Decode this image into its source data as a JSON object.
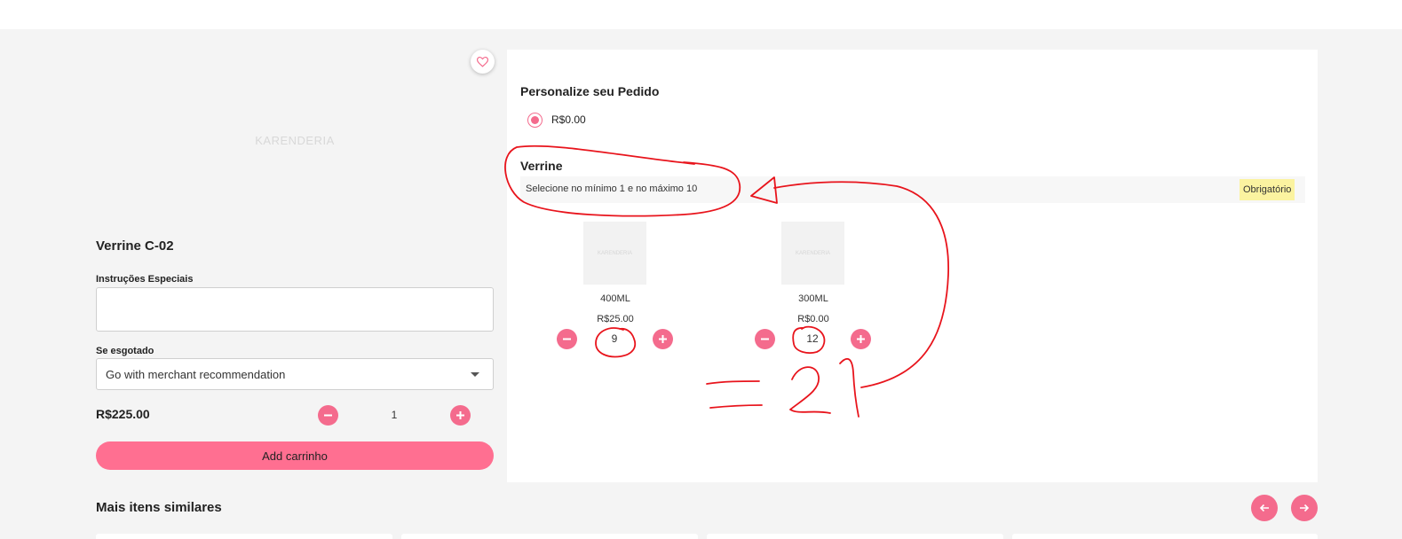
{
  "product": {
    "image_placeholder": "KARENDERIA",
    "title": "Verrine C-02",
    "instructions_label": "Instruções Especiais",
    "instructions_value": "",
    "soldout_label": "Se esgotado",
    "soldout_selected": "Go with merchant recommendation",
    "total_price": "R$225.00",
    "quantity": "1",
    "add_to_cart_label": "Add carrinho"
  },
  "customize": {
    "title": "Personalize seu Pedido",
    "radio_option_label": "R$0.00",
    "radio_selected": true
  },
  "verrine_group": {
    "title": "Verrine",
    "rule_text": "Selecione no mínimo 1 e no máximo 10",
    "required_badge": "Obrigatório",
    "options": [
      {
        "image_placeholder": "KARENDERIA",
        "name": "400ML",
        "price": "R$25.00",
        "quantity": "9"
      },
      {
        "image_placeholder": "KARENDERIA",
        "name": "300ML",
        "price": "R$0.00",
        "quantity": "12"
      }
    ]
  },
  "similar": {
    "title": "Mais itens similares"
  },
  "colors": {
    "accent": "#f46b8d",
    "button": "#ff6f91",
    "badge_bg": "#fbf3a0",
    "annotation": "#e8141c"
  },
  "icons": {
    "favorite": "heart-outline-icon",
    "minus": "minus-icon",
    "plus": "plus-icon",
    "prev": "arrow-left-icon",
    "next": "arrow-right-icon",
    "dropdown": "caret-down-icon"
  },
  "annotation": {
    "handwritten_text": "=21"
  }
}
